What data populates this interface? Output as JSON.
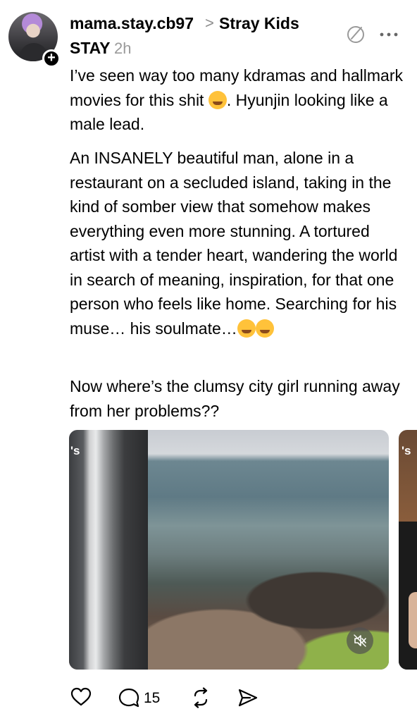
{
  "post": {
    "author": "mama.stay.cb97",
    "chevron": ">",
    "community": "Stray Kids",
    "tag": "STAY",
    "timestamp": "2h",
    "paragraph1_a": "I’ve seen way too many kdramas and hallmark movies for this shit ",
    "paragraph1_b": ". Hyunjin looking like a male lead.",
    "paragraph2": "An INSANELY beautiful man, alone in a restaurant on a secluded island, taking in the kind of somber view that somehow makes everything even more stunning. A tortured artist with a tender heart, wandering the world in search of meaning, inspiration, for that one person who feels like home. Searching for his muse… his soulmate…",
    "paragraph3": "Now where’s the clumsy city girl running away from her problems??",
    "media_label": "'s",
    "media2_label": "'s"
  },
  "actions": {
    "reply_count": "15"
  },
  "icons": {
    "plus": "+",
    "more": "more-icon",
    "edit": "edit-icon",
    "mute": "muted-speaker-icon"
  },
  "colors": {
    "text": "#000000",
    "muted": "#9a9a9a",
    "emoji": "#ffc23a"
  }
}
